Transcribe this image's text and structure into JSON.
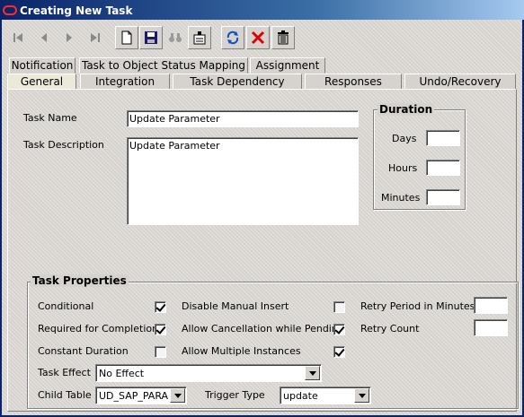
{
  "window": {
    "title": "Creating New Task"
  },
  "toolbar": {
    "icons": [
      "first-icon",
      "previous-icon",
      "next-icon",
      "last-icon",
      "new-icon",
      "save-icon",
      "find-icon",
      "copy-icon",
      "refresh-icon",
      "delete-icon",
      "trash-icon"
    ]
  },
  "tabs": {
    "row1": [
      "Notification",
      "Task to Object Status Mapping",
      "Assignment"
    ],
    "row2": [
      "General",
      "Integration",
      "Task Dependency",
      "Responses",
      "Undo/Recovery"
    ],
    "active": "General"
  },
  "form": {
    "task_name_label": "Task Name",
    "task_name_value": "Update Parameter",
    "task_description_label": "Task Description",
    "task_description_value": "Update Parameter"
  },
  "duration": {
    "title": "Duration",
    "days_label": "Days",
    "hours_label": "Hours",
    "minutes_label": "Minutes",
    "days_value": "",
    "hours_value": "",
    "minutes_value": ""
  },
  "properties": {
    "title": "Task Properties",
    "conditional_label": "Conditional",
    "conditional_checked": true,
    "required_label": "Required for Completion",
    "required_checked": true,
    "constant_label": "Constant Duration",
    "constant_checked": false,
    "disable_manual_label": "Disable Manual Insert",
    "disable_manual_checked": false,
    "allow_cancel_label": "Allow Cancellation while Pending",
    "allow_cancel_checked": true,
    "allow_multiple_label": "Allow Multiple Instances",
    "allow_multiple_checked": true,
    "retry_period_label": "Retry Period in Minutes",
    "retry_period_value": "",
    "retry_count_label": "Retry Count",
    "retry_count_value": "",
    "task_effect_label": "Task Effect",
    "task_effect_value": "No Effect",
    "child_table_label": "Child Table",
    "child_table_value": "UD_SAP_PARA",
    "trigger_type_label": "Trigger Type",
    "trigger_type_value": "update"
  }
}
